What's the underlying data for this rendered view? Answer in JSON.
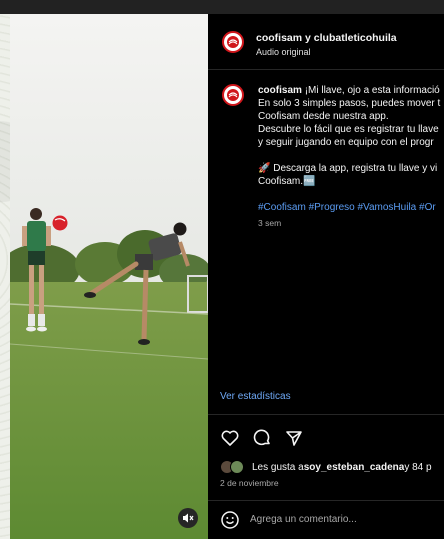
{
  "header": {
    "title": "coofisam y clubatleticohuila",
    "subtitle": "Audio original"
  },
  "caption": {
    "author": "coofisam",
    "line1": "¡Mi llave, ojo a esta informació",
    "line2": "En solo 3 simples pasos, puedes mover t",
    "line3": "Coofisam desde nuestra app.",
    "line4": "Descubre lo fácil que es registrar tu llave",
    "line5": "y seguir jugando en equipo con el progr",
    "line6": "🚀 Descarga la app, registra tu llave y vi",
    "line7": "Coofisam.🆓",
    "hashtags": "#Coofisam #Progreso #VamosHuila #Or",
    "time": "3 sem"
  },
  "stats_link": "Ver estadísticas",
  "likes": {
    "prefix": "Les gusta a ",
    "user": "soy_esteban_cadena",
    "suffix": " y 84 p"
  },
  "date": "2 de noviembre",
  "comment_placeholder": "Agrega un comentario...",
  "colors": {
    "brand_red": "#d0161b",
    "link_blue": "#5b9cf2",
    "panel_bg": "#000000"
  }
}
